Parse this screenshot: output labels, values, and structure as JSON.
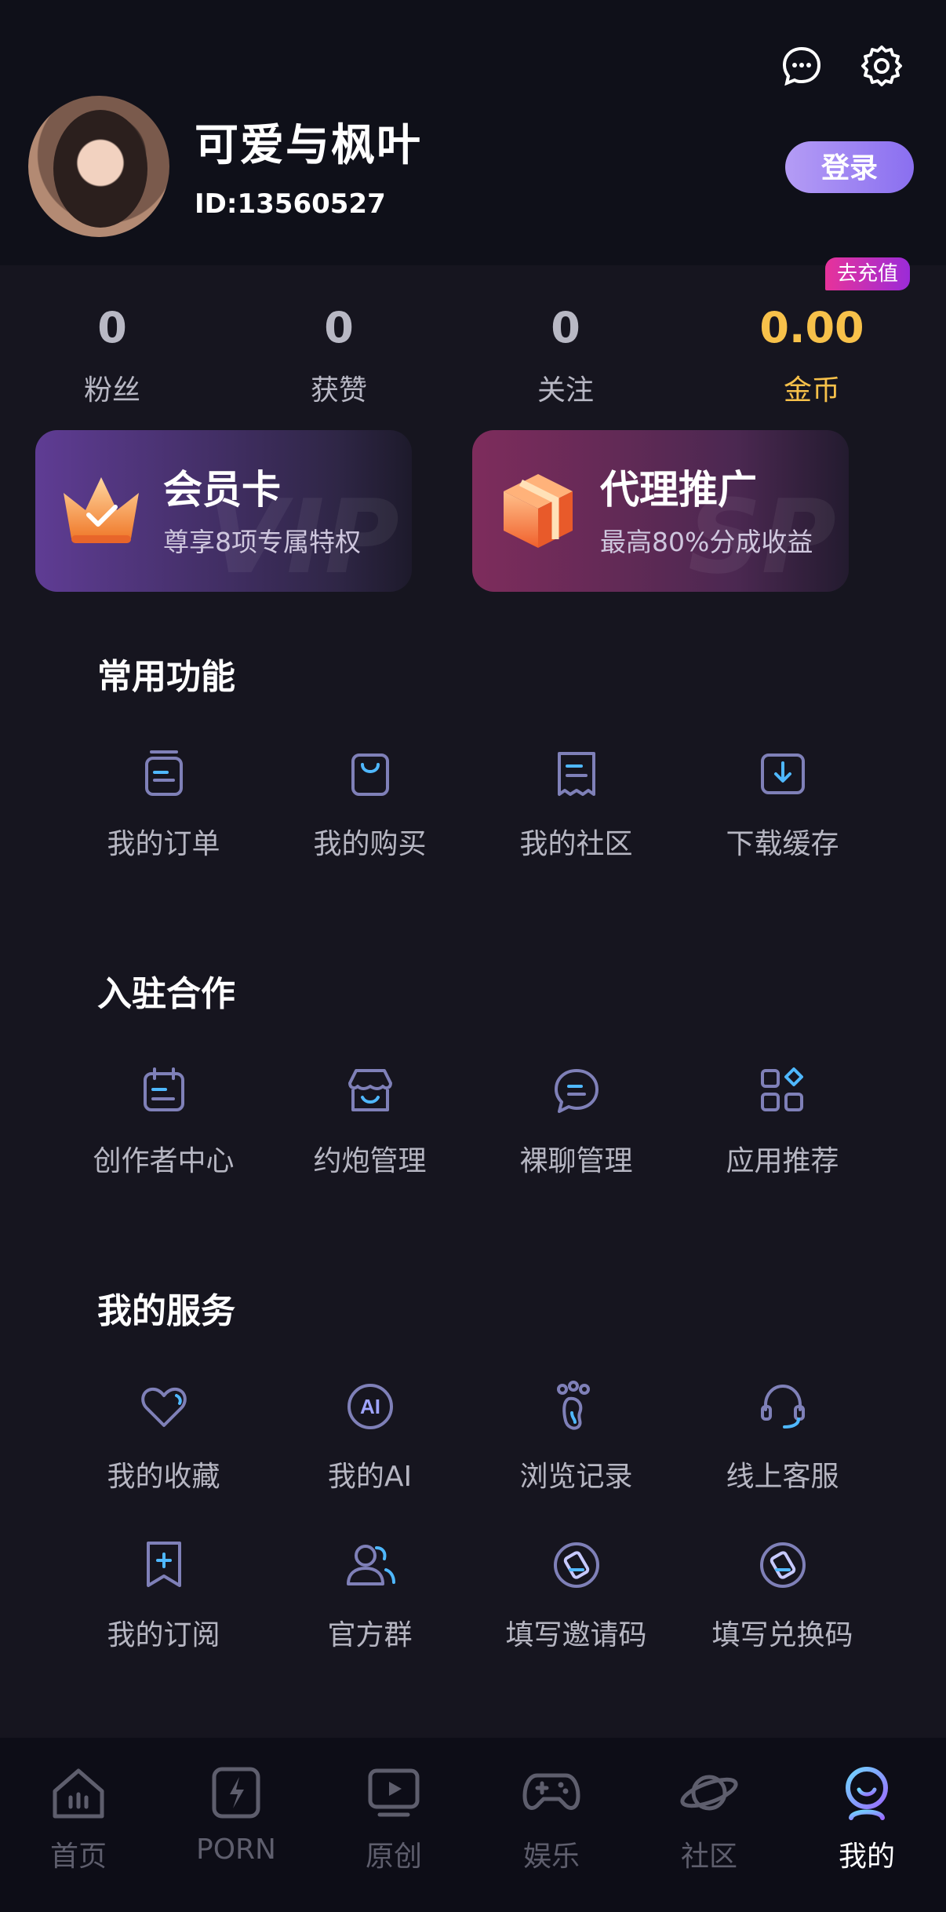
{
  "header": {
    "username": "可爱与枫叶",
    "user_id": "ID:13560527",
    "login_label": "登录",
    "icons": [
      "message-icon",
      "settings-icon"
    ]
  },
  "stats": {
    "recharge_badge": "去充值",
    "items": [
      {
        "value": "0",
        "label": "粉丝"
      },
      {
        "value": "0",
        "label": "获赞"
      },
      {
        "value": "0",
        "label": "关注"
      },
      {
        "value": "0.00",
        "label": "金币"
      }
    ]
  },
  "promos": {
    "vip": {
      "title": "会员卡",
      "subtitle": "尊享8项专属特权",
      "watermark": "VIP"
    },
    "agent": {
      "title": "代理推广",
      "subtitle": "最高80%分成收益",
      "watermark": "SP"
    }
  },
  "sections": {
    "common": {
      "title": "常用功能",
      "items": [
        "我的订单",
        "我的购买",
        "我的社区",
        "下载缓存"
      ]
    },
    "cooperation": {
      "title": "入驻合作",
      "items": [
        "创作者中心",
        "约炮管理",
        "裸聊管理",
        "应用推荐"
      ]
    },
    "services": {
      "title": "我的服务",
      "items": [
        "我的收藏",
        "我的AI",
        "浏览记录",
        "线上客服",
        "我的订阅",
        "官方群",
        "填写邀请码",
        "填写兑换码"
      ]
    }
  },
  "tabbar": {
    "items": [
      "首页",
      "PORN",
      "原创",
      "娱乐",
      "社区",
      "我的"
    ],
    "active_index": 5
  },
  "colors": {
    "background": "#16151f",
    "gold": "#f7c14a",
    "accent": "#8a6ff0",
    "icon_stroke": "#7f80b8"
  }
}
